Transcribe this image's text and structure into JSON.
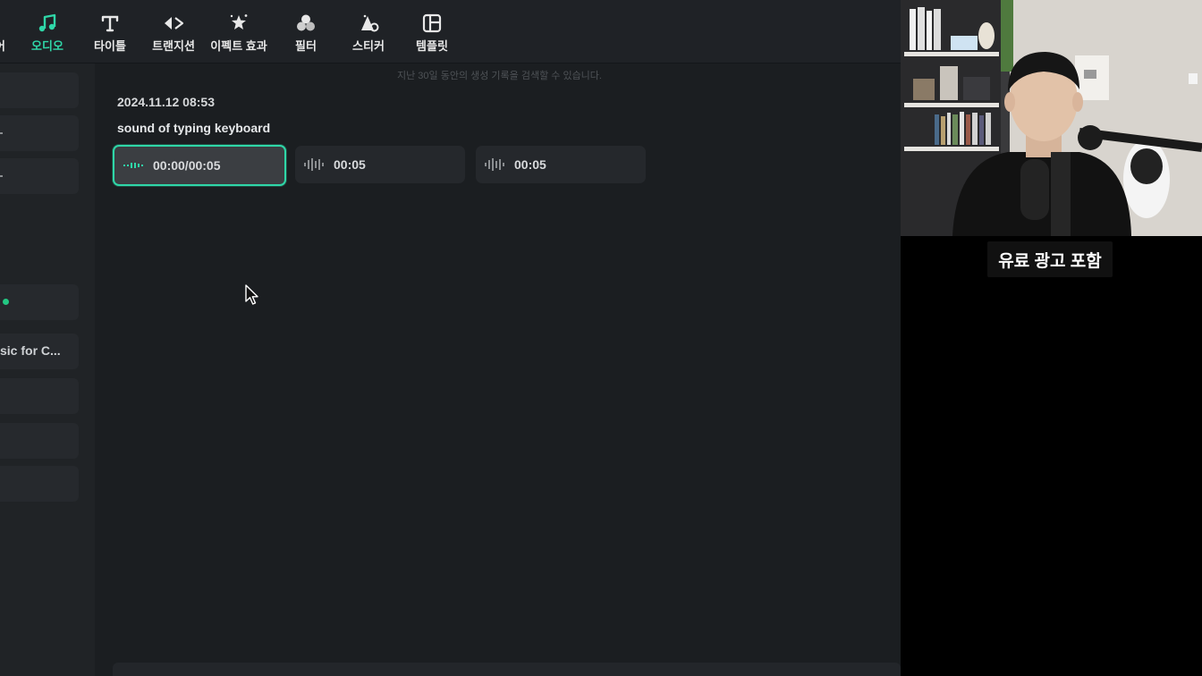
{
  "toolbar": {
    "items": [
      {
        "label": "어",
        "icon": "media-icon"
      },
      {
        "label": "오디오",
        "icon": "music-note-icon",
        "active": true
      },
      {
        "label": "타이틀",
        "icon": "title-text-icon"
      },
      {
        "label": "트랜지션",
        "icon": "transition-icon"
      },
      {
        "label": "이펙트 효과",
        "icon": "effects-sparkle-icon"
      },
      {
        "label": "필터",
        "icon": "filter-circles-icon"
      },
      {
        "label": "스티커",
        "icon": "sticker-icon"
      },
      {
        "label": "템플릿",
        "icon": "template-layout-icon"
      }
    ]
  },
  "sidebar": {
    "items": [
      {
        "label": ""
      },
      {
        "label": ""
      },
      {
        "label": ""
      },
      {
        "label": ""
      },
      {
        "label": "sic for C..."
      },
      {
        "label": ""
      },
      {
        "label": ""
      },
      {
        "label": ""
      }
    ]
  },
  "main": {
    "hint": "지난 30일 동안의 생성 기록을 검색할 수 있습니다.",
    "timestamp": "2024.11.12 08:53",
    "prompt": "sound of typing keyboard",
    "clips": [
      {
        "time": "00:00/00:05",
        "selected": true
      },
      {
        "time": "00:05",
        "selected": false
      },
      {
        "time": "00:05",
        "selected": false
      }
    ]
  },
  "overlay": {
    "caption": "유료 광고 포함"
  },
  "colors": {
    "accent": "#2fd7a8",
    "background": "#1b1e21",
    "toolbar": "#1f2226",
    "clip": "#25282c"
  }
}
